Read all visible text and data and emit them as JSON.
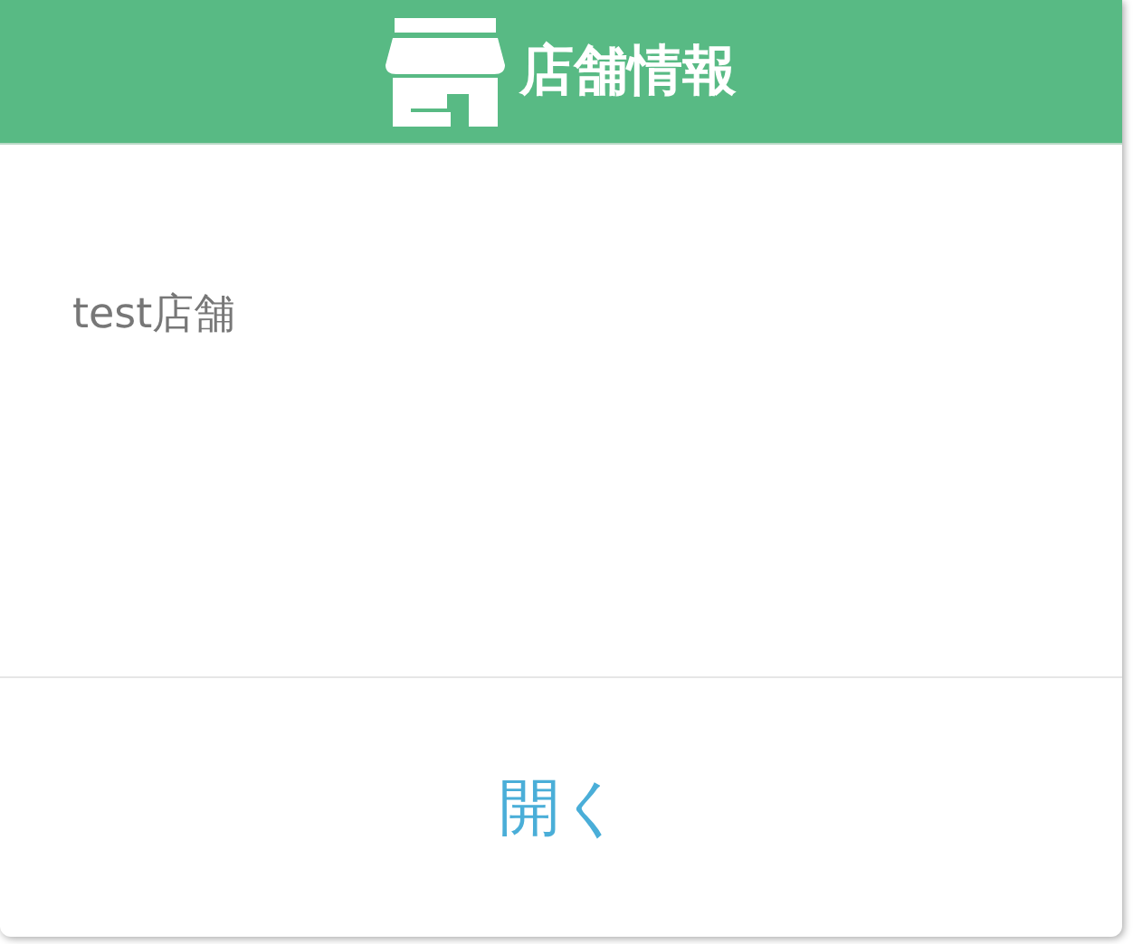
{
  "header": {
    "title": "店舗情報"
  },
  "body": {
    "text": "test店舗"
  },
  "footer": {
    "button": "開く"
  }
}
